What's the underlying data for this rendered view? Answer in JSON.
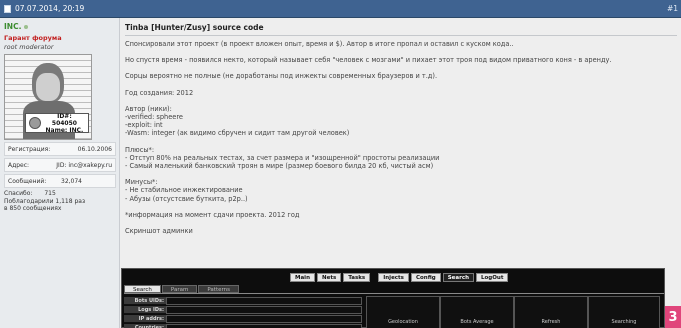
{
  "post": {
    "date": "07.07.2014, 20:19",
    "number": "#1"
  },
  "author": {
    "username": "INC.",
    "group_title": "Гарант форума",
    "subtitle": "root moderator",
    "id_plate": {
      "id_line": "ID#: 504050",
      "name_line": "Name: INC."
    },
    "registration_label": "Регистрация:",
    "registration_value": "06.10.2006",
    "address_label": "Адрес:",
    "address_value": "JID: inc@xakepy.ru",
    "messages_label": "Сообщений:",
    "messages_value": "32,074",
    "thanks_line": "Спасибо:",
    "thanks_value": "715",
    "thanked_line": "Поблагодарили 1,118 раз",
    "thanked_line2": "в 850 сообщениях"
  },
  "body": {
    "title": "Tinba [Hunter/Zusy] source code",
    "paragraphs": [
      [
        "Спонсировали этот проект (в проект вложен опыт, время и $). Автор в итоге пропал и оставил с куском кода.."
      ],
      [
        "Но спустя время - появился некто, который называет себя \"человек с мозгами\" и пихает этот троя под видом приватного коня - в аренду."
      ],
      [
        "Сорцы вероятно не полные (не доработаны под инжекты современных браузеров и т.д)."
      ],
      [
        "Год создания: 2012"
      ],
      [
        "Автор (ники):",
        "-verified: spheere",
        "-exploit: int",
        "-Wasm: integer (ак видимо сбручен и сидит там другой человек)"
      ],
      [
        "Плюсы*:",
        "- Отступ 80% на реальных тестах, за счет размера и \"изощренной\" простоты реализации",
        "- Самый маленький банковский троян в мире (размер боевого билда 20 кб, чистый асм)"
      ],
      [
        "Минусы*:",
        "- Не стабильное инжектирование",
        "- Абузы (отсустсвие буткита, p2p..)"
      ],
      [
        "*информация на момент сдачи проекта. 2012 год"
      ],
      [
        "Скриншот админки"
      ]
    ]
  },
  "admin_panel": {
    "menu": [
      "Main",
      "Nets",
      "Tasks",
      "Injects",
      "Config",
      "Search",
      "LogOut"
    ],
    "tabs": [
      "Search",
      "Param",
      "Patterns"
    ],
    "fields": [
      "Bots UIDs:",
      "Logs IDs:",
      "IP addrs:",
      "Countries:"
    ],
    "columns": [
      "Geolocation",
      "Bots Average",
      "Refresh",
      "Searching"
    ]
  },
  "badge": "3",
  "colors": {
    "header_bg": "#3f6391",
    "username": "#3c8c2f",
    "group_title": "#c21f1f",
    "badge": "#e0457b"
  }
}
